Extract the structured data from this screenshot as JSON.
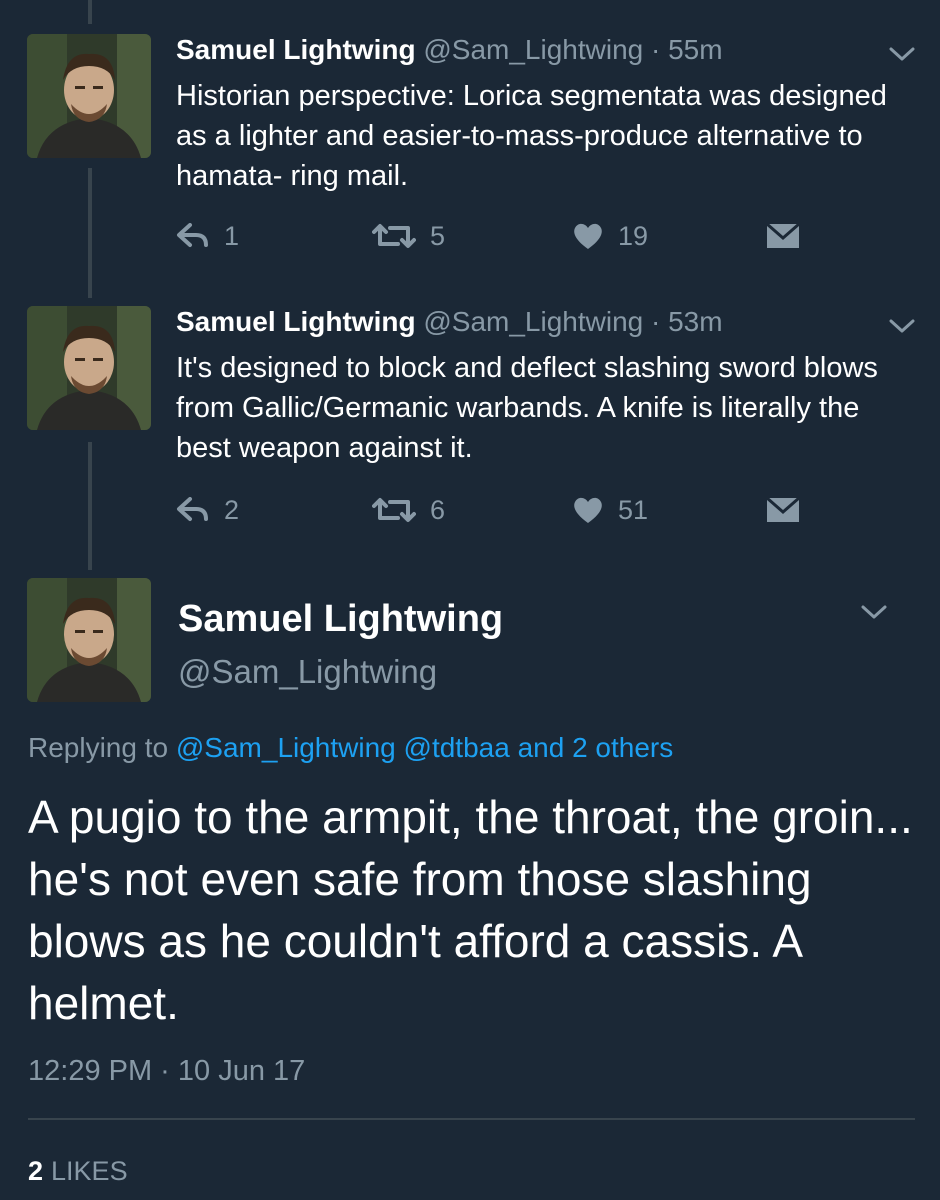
{
  "colors": {
    "background": "#1b2836",
    "text_primary": "#ffffff",
    "text_secondary": "#8899a6",
    "link": "#1da1f2",
    "divider": "#38444d"
  },
  "thread": [
    {
      "display_name": "Samuel Lightwing",
      "handle": "@Sam_Lightwing",
      "time": "· 55m",
      "text": "Historian perspective: Lorica segmentata was designed as a lighter and easier-to-mass-produce alternative to hamata- ring mail.",
      "replies": "1",
      "retweets": "5",
      "likes": "19"
    },
    {
      "display_name": "Samuel Lightwing",
      "handle": "@Sam_Lightwing",
      "time": "· 53m",
      "text": "It's designed to block and deflect slashing sword blows from Gallic/Germanic warbands. A knife is literally the best weapon against it.",
      "replies": "2",
      "retweets": "6",
      "likes": "51"
    }
  ],
  "focused": {
    "display_name": "Samuel Lightwing",
    "handle": "@Sam_Lightwing",
    "replying_prefix": "Replying to",
    "replying_users": "@Sam_Lightwing @tdtbaa and 2 others",
    "text": "A pugio to the armpit, the throat, the groin... he's not even safe from those slashing blows as he couldn't afford a cassis. A helmet.",
    "timestamp": "12:29 PM · 10 Jun 17",
    "likes_count": "2",
    "likes_label": "LIKES"
  },
  "icons": {
    "reply": "reply-icon",
    "retweet": "retweet-icon",
    "like": "heart-icon",
    "dm": "envelope-icon",
    "menu": "chevron-down-icon"
  }
}
